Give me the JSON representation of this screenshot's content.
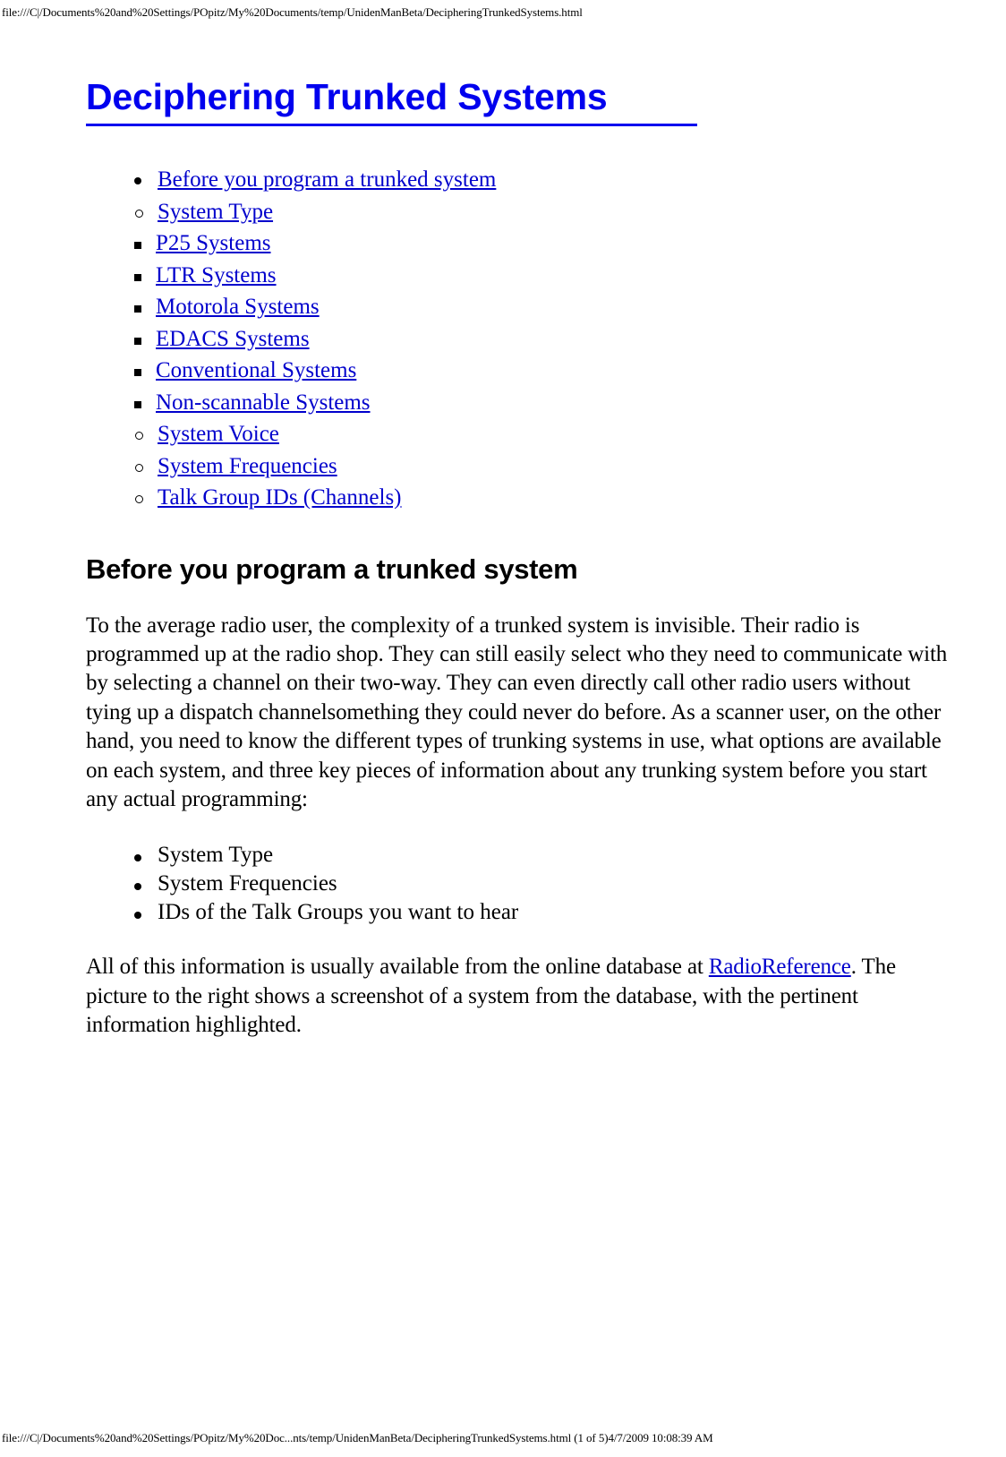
{
  "browser": {
    "header_url": "file:///C|/Documents%20and%20Settings/POpitz/My%20Documents/temp/UnidenManBeta/DecipheringTrunkedSystems.html",
    "footer_url": "file:///C|/Documents%20and%20Settings/POpitz/My%20Doc...nts/temp/UnidenManBeta/DecipheringTrunkedSystems.html (1 of 5)4/7/2009 10:08:39 AM"
  },
  "colors": {
    "link": "#0000cc",
    "title": "#0000ee",
    "text": "#000000",
    "background": "#ffffff"
  },
  "document": {
    "title": "Deciphering Trunked Systems",
    "toc": [
      {
        "label": "Before you program a trunked system",
        "level": 1,
        "bullet": "disc",
        "link": true
      },
      {
        "label": "System Type",
        "level": 2,
        "bullet": "circle",
        "link": true
      },
      {
        "label": "P25 Systems",
        "level": 3,
        "bullet": "square",
        "link": true
      },
      {
        "label": "LTR Systems",
        "level": 3,
        "bullet": "square",
        "link": true
      },
      {
        "label": "Motorola Systems",
        "level": 3,
        "bullet": "square",
        "link": true
      },
      {
        "label": "EDACS Systems",
        "level": 3,
        "bullet": "square",
        "link": true
      },
      {
        "label": "Conventional Systems",
        "level": 3,
        "bullet": "square",
        "link": true
      },
      {
        "label": "Non-scannable Systems",
        "level": 3,
        "bullet": "square",
        "link": true
      },
      {
        "label": "System Voice",
        "level": 2,
        "bullet": "circle",
        "link": true
      },
      {
        "label": "System Frequencies",
        "level": 2,
        "bullet": "circle",
        "link": true
      },
      {
        "label": "Talk Group IDs (Channels)",
        "level": 2,
        "bullet": "circle",
        "link": true
      }
    ],
    "section_heading": "Before you program a trunked system",
    "paragraph_1": "To the average radio user, the complexity of a trunked system is invisible. Their radio is programmed up at the radio shop. They can still easily select who they need to communicate with by selecting a channel on their two-way. They can even directly call other radio users without tying up a dispatch channelsomething they could never do before. As a scanner user, on the other hand, you need to know the different types of trunking systems in use, what options are available on each system, and three key pieces of information about any trunking system before you start any actual programming:",
    "key_info_list": [
      "System Type",
      "System Frequencies",
      "IDs of the Talk Groups you want to hear"
    ],
    "paragraph_2_part1": "All of this information is usually available from the online database at ",
    "paragraph_2_link": "RadioReference",
    "paragraph_2_part2": ". The picture to the right shows a screenshot of a system from the database, with the pertinent information highlighted."
  }
}
